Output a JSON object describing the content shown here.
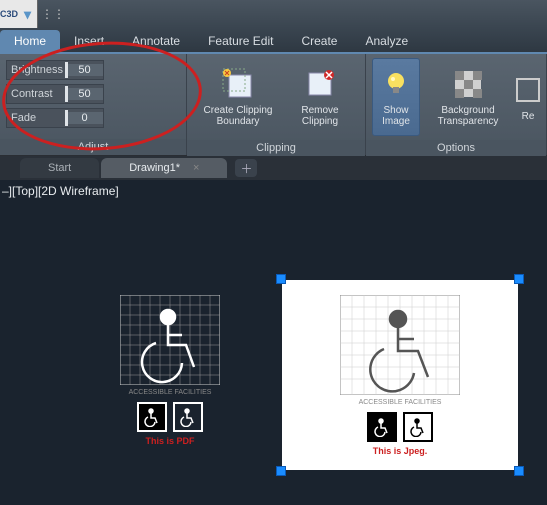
{
  "app": {
    "logo_text": "C3D"
  },
  "tabs": [
    "Home",
    "Insert",
    "Annotate",
    "Feature Edit",
    "Create",
    "Analyze"
  ],
  "active_tab": "Home",
  "ribbon": {
    "adjust": {
      "title": "Adjust",
      "items": [
        {
          "label": "Brightness",
          "value": "50",
          "thumb_pct": 10
        },
        {
          "label": "Contrast",
          "value": "50",
          "thumb_pct": 8
        },
        {
          "label": "Fade",
          "value": "0",
          "thumb_pct": 0
        }
      ]
    },
    "clipping": {
      "title": "Clipping",
      "buttons": [
        {
          "label": "Create Clipping Boundary"
        },
        {
          "label": "Remove Clipping"
        }
      ]
    },
    "options": {
      "title": "Options",
      "buttons": [
        {
          "label": "Show Image",
          "active": true
        },
        {
          "label": "Background Transparency"
        },
        {
          "label": "Re"
        }
      ]
    }
  },
  "doc_tabs": [
    {
      "label": "Start"
    },
    {
      "label": "Drawing1*",
      "active": true
    }
  ],
  "view_label": "–][Top][2D Wireframe]",
  "canvas": {
    "pdf_caption": "This is PDF",
    "jpeg_caption": "This is Jpeg."
  }
}
